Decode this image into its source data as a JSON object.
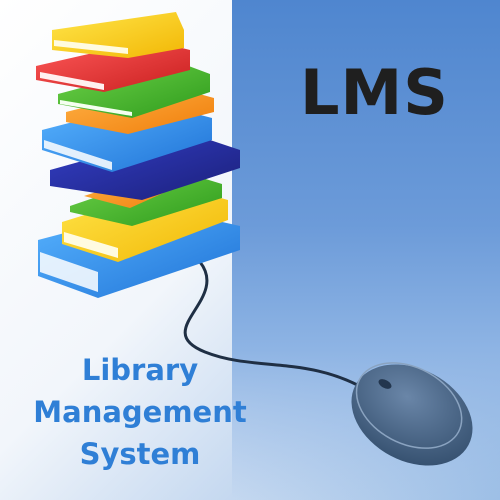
{
  "logo_text": "LMS",
  "title_lines": [
    "Library",
    "Management",
    "System"
  ],
  "colors": {
    "panel_blue": "#5a8fd4",
    "title_blue": "#2f7fd6",
    "logo_text": "#1f1f1f"
  },
  "illustration": {
    "subject": "books-stack-icon",
    "accessory": "computer-mouse-icon"
  }
}
